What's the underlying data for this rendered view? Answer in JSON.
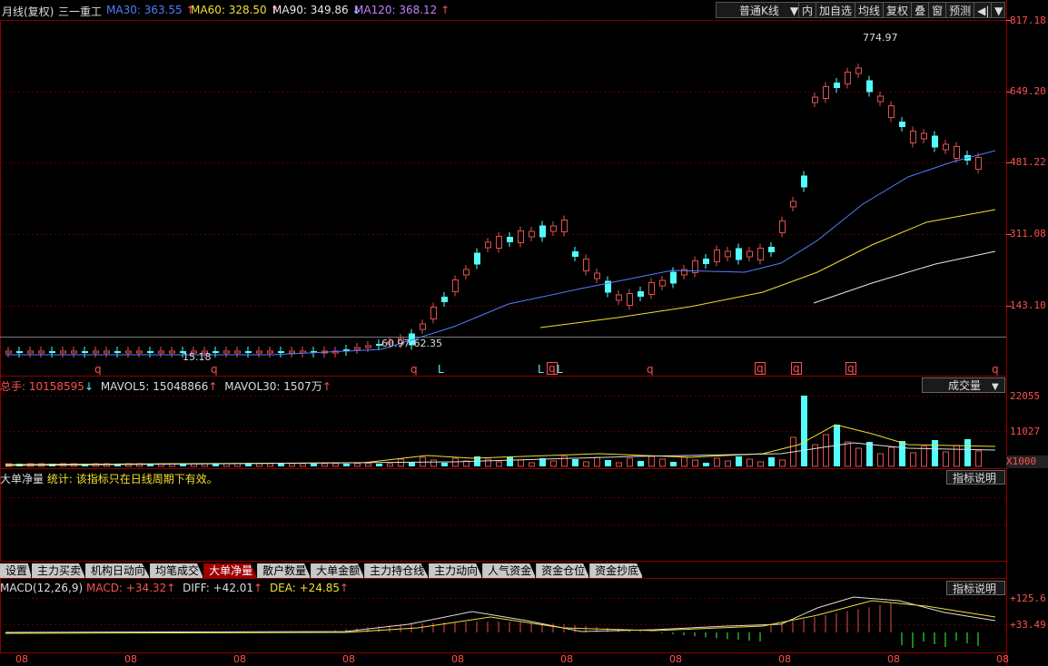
{
  "header": {
    "title": "月线(复权)",
    "stock": "三一重工",
    "ma": [
      {
        "label": "MA30: ",
        "value": "363.55",
        "arrow": "↑",
        "color": "#4f7fff"
      },
      {
        "label": "MA60: ",
        "value": "328.50",
        "arrow": "↑",
        "color": "#f0e030"
      },
      {
        "label": "MA90: ",
        "value": "349.86",
        "arrow": "↓",
        "color": "#e8e8e8"
      },
      {
        "label": "MA120: ",
        "value": "368.12",
        "arrow": "↑",
        "color": "#c080ff"
      }
    ]
  },
  "toolbar": {
    "kline_type": "普通K线",
    "buttons": [
      "内",
      "加自选",
      "均线",
      "复权",
      "叠",
      "窗",
      "预测"
    ]
  },
  "main_axis": [
    "817.18",
    "649.20",
    "481.22",
    "311.08",
    "143.10"
  ],
  "annotations": {
    "high": "774.97",
    "low": "15.18",
    "range": "60.97-62.35"
  },
  "signal_labels": [
    "q",
    "q",
    "q",
    "L",
    "L",
    "q",
    "L",
    "q",
    "q",
    "q",
    "q",
    "q"
  ],
  "volume": {
    "total_label": "总手: ",
    "total_value": "10158595",
    "total_arrow": "↓",
    "mavol5_label": "MAVOL5: ",
    "mavol5_value": "15048866",
    "mavol5_arrow": "↑",
    "mavol30_label": "MAVOL30: ",
    "mavol30_value": "1507万",
    "mavol30_arrow": "↑",
    "selector": "成交量",
    "axis": [
      "22055",
      "11027",
      "X1000"
    ]
  },
  "bigorder": {
    "title": "大单净量",
    "note": "统计: 该指标只在日线周期下有效。",
    "help": "指标说明"
  },
  "tabs": [
    "设置",
    "主力买卖",
    "机构日动向",
    "均笔成交",
    "大单净量",
    "散户数量",
    "大单金额",
    "主力持仓线",
    "主力动向",
    "人气资金",
    "资金仓位",
    "资金抄底"
  ],
  "active_tab": "大单净量",
  "macd": {
    "name": "MACD(12,26,9)",
    "macd_label": "MACD: ",
    "macd_value": "+34.32",
    "diff_label": "DIFF: ",
    "diff_value": "+42.01",
    "dea_label": "DEA: ",
    "dea_value": "+24.85",
    "help": "指标说明",
    "axis": [
      "+125.6",
      "+33.49"
    ]
  },
  "time_axis": [
    "08",
    "08",
    "08",
    "08",
    "08",
    "08",
    "08",
    "08",
    "08",
    "08"
  ],
  "colors": {
    "up": "#e05050",
    "down": "#54fcfc",
    "ma30": "#4f7fff",
    "ma60": "#f0e030",
    "ma90": "#e8e8e8",
    "grid": "#7a0000"
  }
}
